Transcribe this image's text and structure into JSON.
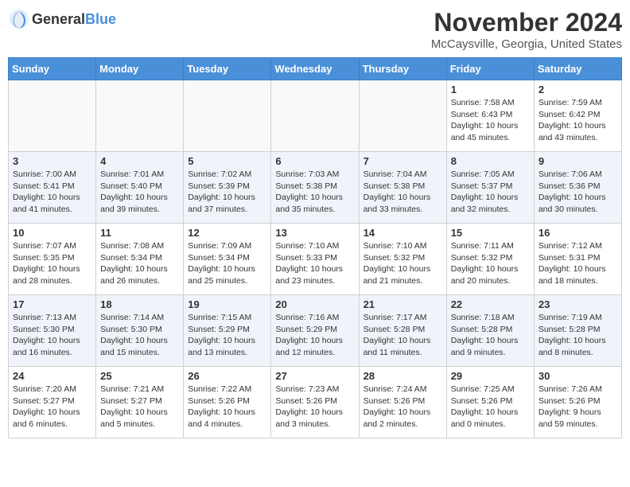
{
  "logo": {
    "general": "General",
    "blue": "Blue"
  },
  "title": "November 2024",
  "location": "McCaysville, Georgia, United States",
  "weekdays": [
    "Sunday",
    "Monday",
    "Tuesday",
    "Wednesday",
    "Thursday",
    "Friday",
    "Saturday"
  ],
  "weeks": [
    [
      {
        "day": "",
        "info": ""
      },
      {
        "day": "",
        "info": ""
      },
      {
        "day": "",
        "info": ""
      },
      {
        "day": "",
        "info": ""
      },
      {
        "day": "",
        "info": ""
      },
      {
        "day": "1",
        "info": "Sunrise: 7:58 AM\nSunset: 6:43 PM\nDaylight: 10 hours and 45 minutes."
      },
      {
        "day": "2",
        "info": "Sunrise: 7:59 AM\nSunset: 6:42 PM\nDaylight: 10 hours and 43 minutes."
      }
    ],
    [
      {
        "day": "3",
        "info": "Sunrise: 7:00 AM\nSunset: 5:41 PM\nDaylight: 10 hours and 41 minutes."
      },
      {
        "day": "4",
        "info": "Sunrise: 7:01 AM\nSunset: 5:40 PM\nDaylight: 10 hours and 39 minutes."
      },
      {
        "day": "5",
        "info": "Sunrise: 7:02 AM\nSunset: 5:39 PM\nDaylight: 10 hours and 37 minutes."
      },
      {
        "day": "6",
        "info": "Sunrise: 7:03 AM\nSunset: 5:38 PM\nDaylight: 10 hours and 35 minutes."
      },
      {
        "day": "7",
        "info": "Sunrise: 7:04 AM\nSunset: 5:38 PM\nDaylight: 10 hours and 33 minutes."
      },
      {
        "day": "8",
        "info": "Sunrise: 7:05 AM\nSunset: 5:37 PM\nDaylight: 10 hours and 32 minutes."
      },
      {
        "day": "9",
        "info": "Sunrise: 7:06 AM\nSunset: 5:36 PM\nDaylight: 10 hours and 30 minutes."
      }
    ],
    [
      {
        "day": "10",
        "info": "Sunrise: 7:07 AM\nSunset: 5:35 PM\nDaylight: 10 hours and 28 minutes."
      },
      {
        "day": "11",
        "info": "Sunrise: 7:08 AM\nSunset: 5:34 PM\nDaylight: 10 hours and 26 minutes."
      },
      {
        "day": "12",
        "info": "Sunrise: 7:09 AM\nSunset: 5:34 PM\nDaylight: 10 hours and 25 minutes."
      },
      {
        "day": "13",
        "info": "Sunrise: 7:10 AM\nSunset: 5:33 PM\nDaylight: 10 hours and 23 minutes."
      },
      {
        "day": "14",
        "info": "Sunrise: 7:10 AM\nSunset: 5:32 PM\nDaylight: 10 hours and 21 minutes."
      },
      {
        "day": "15",
        "info": "Sunrise: 7:11 AM\nSunset: 5:32 PM\nDaylight: 10 hours and 20 minutes."
      },
      {
        "day": "16",
        "info": "Sunrise: 7:12 AM\nSunset: 5:31 PM\nDaylight: 10 hours and 18 minutes."
      }
    ],
    [
      {
        "day": "17",
        "info": "Sunrise: 7:13 AM\nSunset: 5:30 PM\nDaylight: 10 hours and 16 minutes."
      },
      {
        "day": "18",
        "info": "Sunrise: 7:14 AM\nSunset: 5:30 PM\nDaylight: 10 hours and 15 minutes."
      },
      {
        "day": "19",
        "info": "Sunrise: 7:15 AM\nSunset: 5:29 PM\nDaylight: 10 hours and 13 minutes."
      },
      {
        "day": "20",
        "info": "Sunrise: 7:16 AM\nSunset: 5:29 PM\nDaylight: 10 hours and 12 minutes."
      },
      {
        "day": "21",
        "info": "Sunrise: 7:17 AM\nSunset: 5:28 PM\nDaylight: 10 hours and 11 minutes."
      },
      {
        "day": "22",
        "info": "Sunrise: 7:18 AM\nSunset: 5:28 PM\nDaylight: 10 hours and 9 minutes."
      },
      {
        "day": "23",
        "info": "Sunrise: 7:19 AM\nSunset: 5:28 PM\nDaylight: 10 hours and 8 minutes."
      }
    ],
    [
      {
        "day": "24",
        "info": "Sunrise: 7:20 AM\nSunset: 5:27 PM\nDaylight: 10 hours and 6 minutes."
      },
      {
        "day": "25",
        "info": "Sunrise: 7:21 AM\nSunset: 5:27 PM\nDaylight: 10 hours and 5 minutes."
      },
      {
        "day": "26",
        "info": "Sunrise: 7:22 AM\nSunset: 5:26 PM\nDaylight: 10 hours and 4 minutes."
      },
      {
        "day": "27",
        "info": "Sunrise: 7:23 AM\nSunset: 5:26 PM\nDaylight: 10 hours and 3 minutes."
      },
      {
        "day": "28",
        "info": "Sunrise: 7:24 AM\nSunset: 5:26 PM\nDaylight: 10 hours and 2 minutes."
      },
      {
        "day": "29",
        "info": "Sunrise: 7:25 AM\nSunset: 5:26 PM\nDaylight: 10 hours and 0 minutes."
      },
      {
        "day": "30",
        "info": "Sunrise: 7:26 AM\nSunset: 5:26 PM\nDaylight: 9 hours and 59 minutes."
      }
    ]
  ]
}
